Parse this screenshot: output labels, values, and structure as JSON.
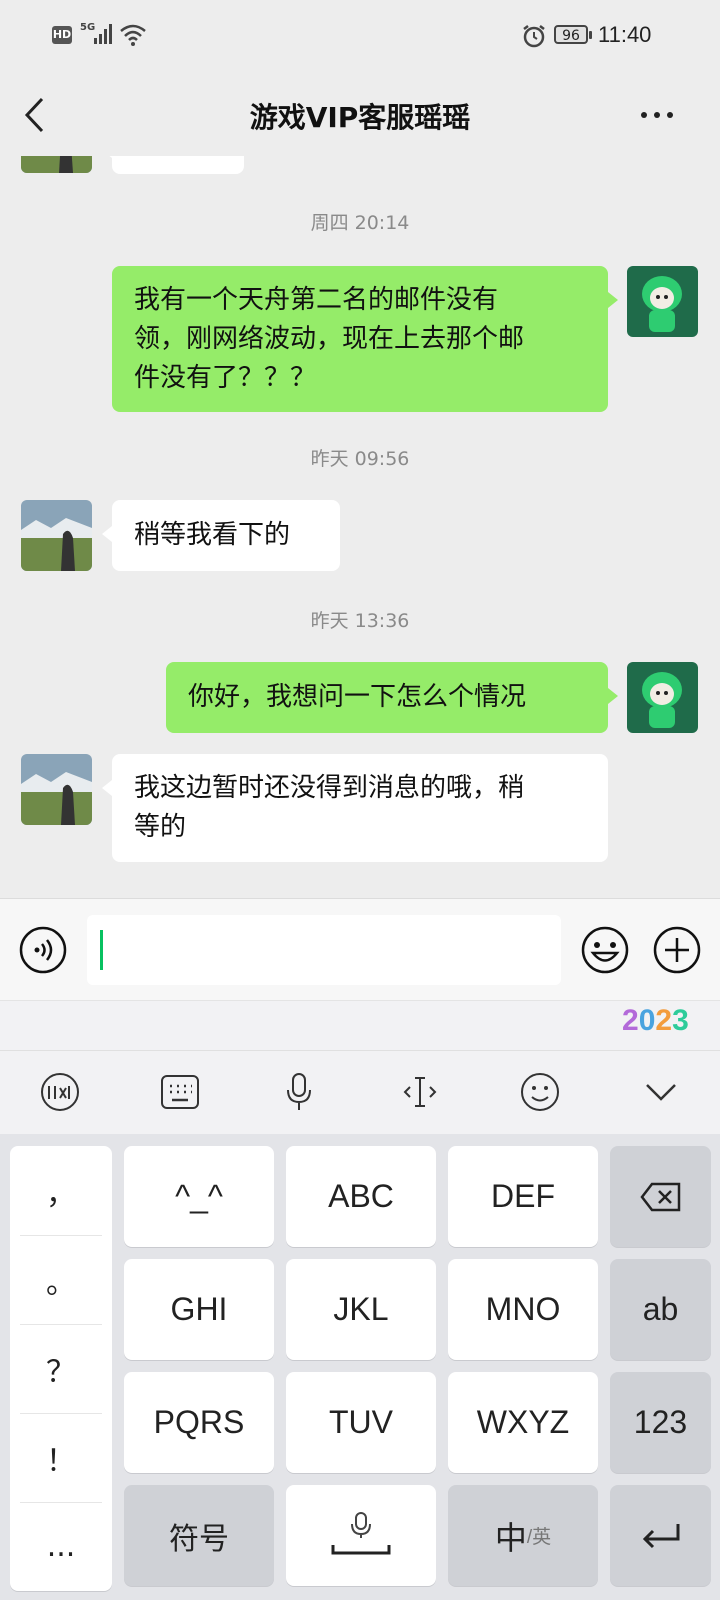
{
  "status_bar": {
    "hd": "HD",
    "network": "5G",
    "battery": "96",
    "time": "11:40"
  },
  "header": {
    "title": "游戏VIP客服瑶瑶"
  },
  "timestamps": [
    "周四 20:14",
    "昨天 09:56",
    "昨天 13:36"
  ],
  "messages": [
    {
      "sender": "me",
      "lines": [
        "我有一个天舟第二名的邮件没有",
        "领，刚网络波动，现在上去那个邮",
        "件没有了？？？"
      ]
    },
    {
      "sender": "agent",
      "lines": [
        "稍等我看下的"
      ]
    },
    {
      "sender": "me",
      "lines": [
        "你好，我想问一下怎么个情况"
      ]
    },
    {
      "sender": "agent",
      "lines": [
        "我这边暂时还没得到消息的哦，稍",
        "等的"
      ]
    }
  ],
  "input": {
    "value": ""
  },
  "ime": {
    "badge": {
      "d1": "2",
      "d2": "0",
      "d3": "2",
      "d4": "3"
    },
    "punctuation": [
      "，",
      "。",
      "？",
      "！",
      "..."
    ],
    "keys": {
      "kaomoji": "^_^",
      "abc": "ABC",
      "def": "DEF",
      "ghi": "GHI",
      "jkl": "JKL",
      "mno": "MNO",
      "ab": "ab",
      "pqrs": "PQRS",
      "tuv": "TUV",
      "wxyz": "WXYZ",
      "num": "123",
      "symbols": "符号",
      "lang_main": "中",
      "lang_sub": "/英"
    }
  },
  "colors": {
    "me_bubble": "#95ec69",
    "agent_bubble": "#ffffff",
    "background": "#ededed",
    "caret": "#07c160"
  }
}
